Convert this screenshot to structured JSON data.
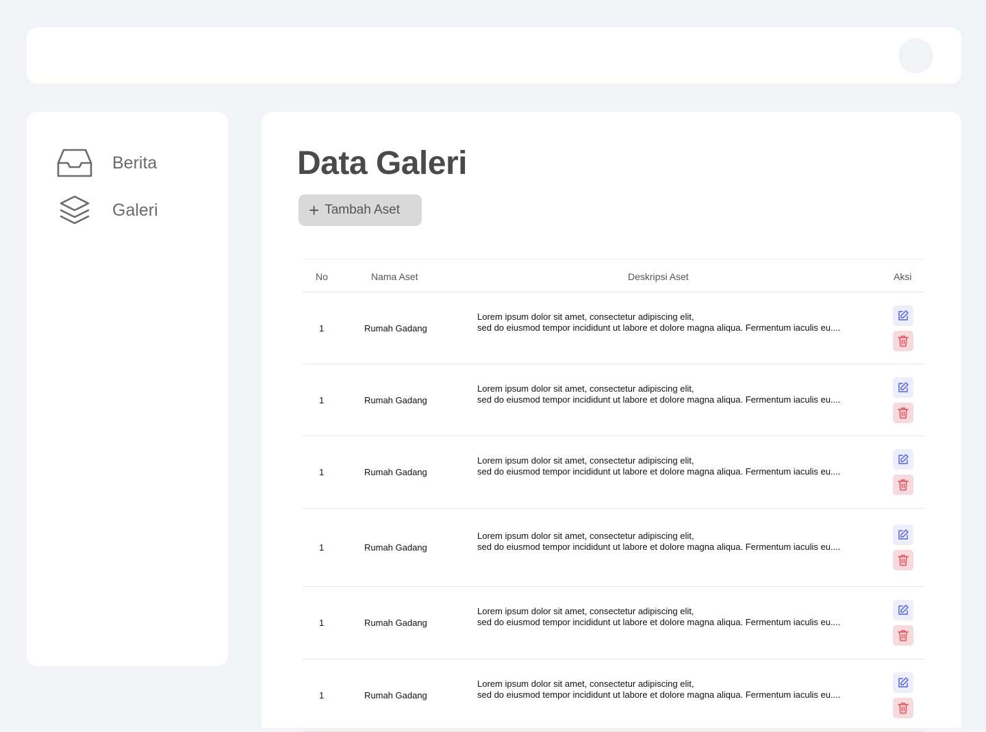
{
  "sidebar": {
    "items": [
      {
        "label": "Berita",
        "icon": "inbox-icon"
      },
      {
        "label": "Galeri",
        "icon": "layers-icon"
      }
    ]
  },
  "main": {
    "title": "Data Galeri",
    "add_button": {
      "label": "Tambah Aset",
      "icon": "plus-icon"
    },
    "table": {
      "headers": {
        "no": "No",
        "name": "Nama Aset",
        "desc": "Deskripsi Aset",
        "action": "Aksi"
      },
      "rows": [
        {
          "no": "1",
          "name": "Rumah Gadang",
          "desc1": "Lorem ipsum dolor sit amet, consectetur adipiscing elit,",
          "desc2": "sed do eiusmod tempor incididunt ut labore et dolore magna aliqua. Fermentum iaculis eu...."
        },
        {
          "no": "1",
          "name": "Rumah Gadang",
          "desc1": "Lorem ipsum dolor sit amet, consectetur adipiscing elit,",
          "desc2": "sed do eiusmod tempor incididunt ut labore et dolore magna aliqua. Fermentum iaculis eu...."
        },
        {
          "no": "1",
          "name": "Rumah Gadang",
          "desc1": "Lorem ipsum dolor sit amet, consectetur adipiscing elit,",
          "desc2": "sed do eiusmod tempor incididunt ut labore et dolore magna aliqua. Fermentum iaculis eu...."
        },
        {
          "no": "1",
          "name": "Rumah Gadang",
          "desc1": "Lorem ipsum dolor sit amet, consectetur adipiscing elit,",
          "desc2": "sed do eiusmod tempor incididunt ut labore et dolore magna aliqua. Fermentum iaculis eu...."
        },
        {
          "no": "1",
          "name": "Rumah Gadang",
          "desc1": "Lorem ipsum dolor sit amet, consectetur adipiscing elit,",
          "desc2": "sed do eiusmod tempor incididunt ut labore et dolore magna aliqua. Fermentum iaculis eu...."
        },
        {
          "no": "1",
          "name": "Rumah Gadang",
          "desc1": "Lorem ipsum dolor sit amet, consectetur adipiscing elit,",
          "desc2": "sed do eiusmod tempor incididunt ut labore et dolore magna aliqua. Fermentum iaculis eu...."
        }
      ]
    }
  },
  "colors": {
    "edit_icon": "#6b74e0",
    "delete_icon": "#e2606c",
    "background": "#f2f3f7"
  }
}
